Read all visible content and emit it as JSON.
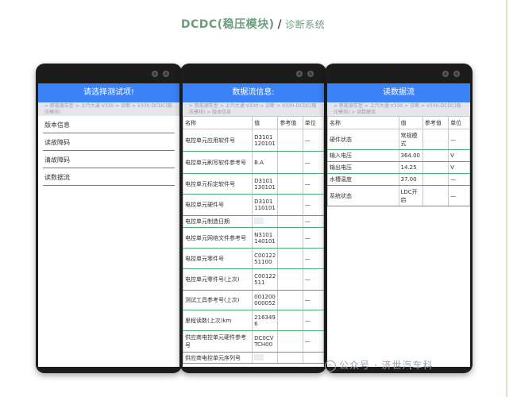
{
  "page_title": {
    "bold": "DCDC(稳压模块)",
    "slash": "/",
    "light": "诊断系统"
  },
  "watermark": "公众号 · 济世汽车科",
  "phones": {
    "left": {
      "title": "请选择测试项!",
      "path": "> 新能源车型 > 上汽大通 V330 > 诊断 > V330-DCDC(稳压模块)",
      "menu": [
        "版本信息",
        "读故障码",
        "清故障码",
        "读数据流"
      ]
    },
    "middle": {
      "title": "数据流信息:",
      "path": "> 新能源车型 > 上汽大通 V330 > 诊断 > V330-DCDC(稳压模块) > 版本信息",
      "headers": [
        "名称",
        "值",
        "参考值",
        "单位"
      ],
      "rows": [
        {
          "name": "电控单元应用软件号",
          "value": "D3101 120101",
          "unit": "—"
        },
        {
          "name": "电控单元刷写软件参考号",
          "value": "B.A",
          "unit": "—"
        },
        {
          "name": "电控单元标定软件号",
          "value": "D3101 130101",
          "unit": "—"
        },
        {
          "name": "电控单元硬件号",
          "value": "D3101 110101",
          "unit": "—"
        },
        {
          "name": "电控单元制造日期",
          "value": "",
          "unit": "—"
        },
        {
          "name": "电控单元网络文件参考号",
          "value": "N3101 140101",
          "unit": "—"
        },
        {
          "name": "电控单元零件号",
          "value": "C00122 51100",
          "unit": "—"
        },
        {
          "name": "电控单元零件号(上次)",
          "value": "C00122 511",
          "unit": "—"
        },
        {
          "name": "测试工具参考号(上次)",
          "value": "001200 000052",
          "unit": "—"
        },
        {
          "name": "里程读数(上次)km",
          "value": "216349 6",
          "unit": "—"
        },
        {
          "name": "供应商电控单元硬件参考号",
          "value": "DC0CV TCH00",
          "unit": "—"
        },
        {
          "name": "供应商电控单元序列号",
          "value": "",
          "unit": ""
        }
      ]
    },
    "right": {
      "title": "读数据流",
      "path": "> 新能源车型 > 上汽大通 V330 > 诊断 > V330-DCDC(稳压模块) > 读数据流",
      "headers": [
        "名称",
        "值",
        "参考值",
        "单位"
      ],
      "rows": [
        {
          "name": "硬件状态",
          "value": "常规模式",
          "unit": "—"
        },
        {
          "name": "输入电压",
          "value": "364.00",
          "unit": "V"
        },
        {
          "name": "输出电压",
          "value": "14.25",
          "unit": "V"
        },
        {
          "name": "水槽温度",
          "value": "37.00",
          "unit": "—"
        },
        {
          "name": "系统状态",
          "value": "LDC开启",
          "unit": "—"
        }
      ]
    }
  }
}
